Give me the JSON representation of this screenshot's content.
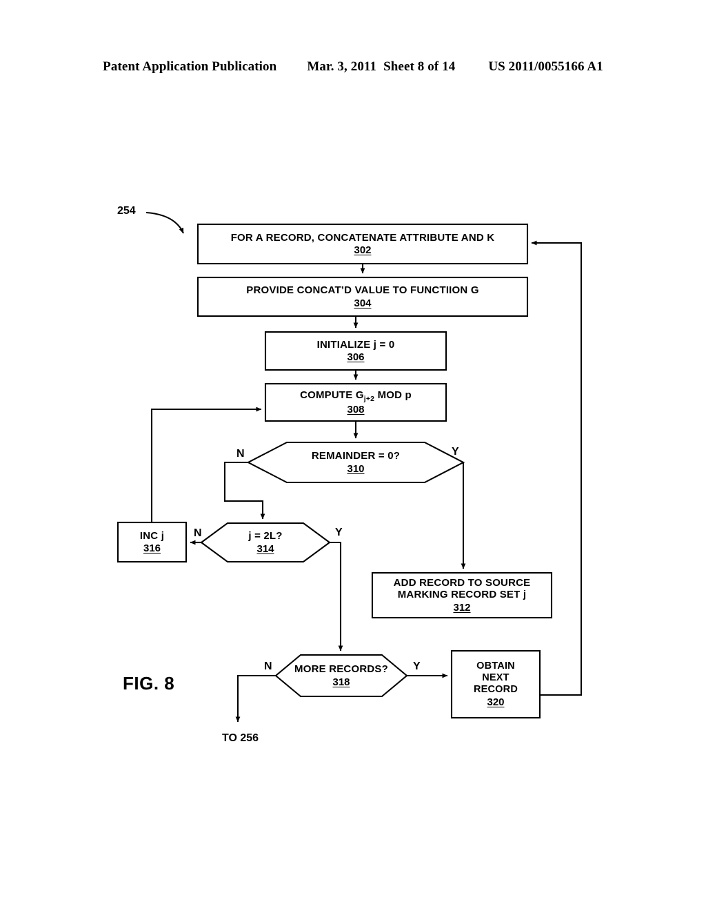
{
  "header": {
    "publication": "Patent Application Publication",
    "date": "Mar. 3, 2011",
    "sheet": "Sheet 8 of 14",
    "document_number": "US 2011/0055166 A1"
  },
  "figure": {
    "label": "FIG. 8",
    "diagram_reference": "254",
    "exit_label": "TO 256"
  },
  "nodes": {
    "n302": {
      "label": "FOR A RECORD, CONCATENATE ATTRIBUTE AND K",
      "ref": "302",
      "shape": "process"
    },
    "n304": {
      "label": "PROVIDE CONCAT’D VALUE TO FUNCTIION G",
      "ref": "304",
      "shape": "process"
    },
    "n306": {
      "label": "INITIALIZE j = 0",
      "ref": "306",
      "shape": "process"
    },
    "n308": {
      "label_pre": "COMPUTE G",
      "label_sub": "j+2",
      "label_post": " MOD p",
      "ref": "308",
      "shape": "process"
    },
    "n310": {
      "label": "REMAINDER = 0?",
      "ref": "310",
      "shape": "decision"
    },
    "n312": {
      "label_line1": "ADD RECORD TO SOURCE",
      "label_line2": "MARKING RECORD SET j",
      "ref": "312",
      "shape": "process"
    },
    "n314": {
      "label": "j = 2L?",
      "ref": "314",
      "shape": "decision"
    },
    "n316": {
      "label": "INC j",
      "ref": "316",
      "shape": "process"
    },
    "n318": {
      "label": "MORE RECORDS?",
      "ref": "318",
      "shape": "decision"
    },
    "n320": {
      "label_line1": "OBTAIN",
      "label_line2": "NEXT",
      "label_line3": "RECORD",
      "ref": "320",
      "shape": "process"
    }
  },
  "branches": {
    "b310_no": "N",
    "b310_yes": "Y",
    "b314_no": "N",
    "b314_yes": "Y",
    "b318_no": "N",
    "b318_yes": "Y"
  },
  "colors": {
    "stroke": "#000000",
    "background": "#ffffff"
  }
}
